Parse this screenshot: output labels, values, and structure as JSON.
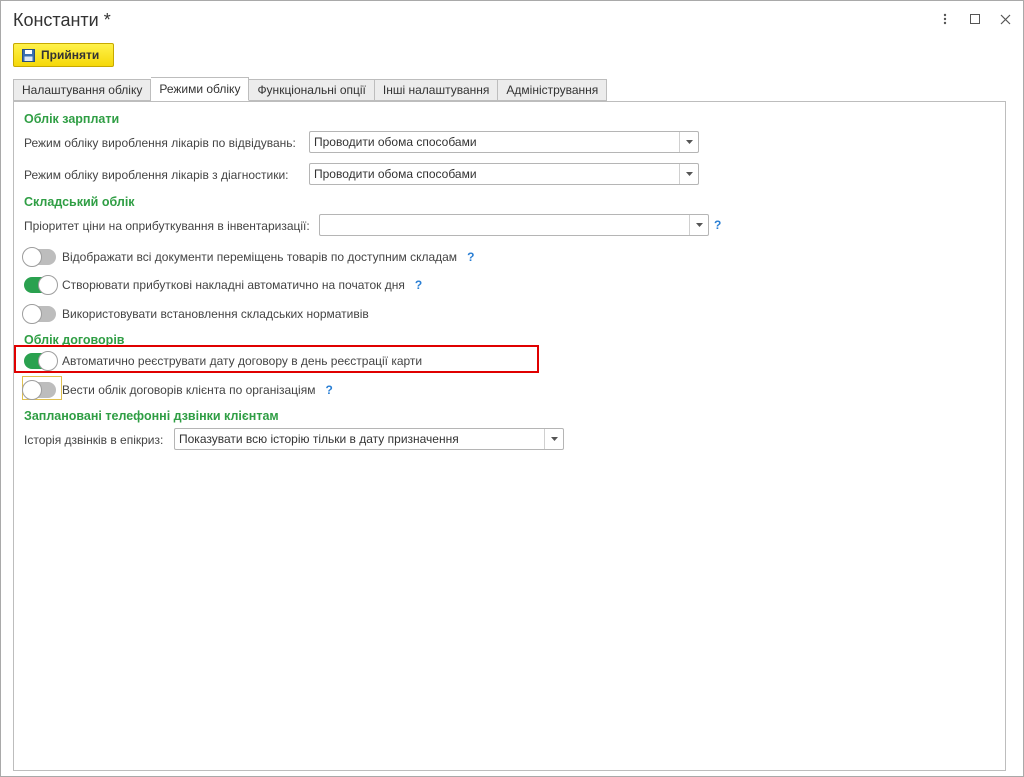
{
  "window": {
    "title": "Константи *"
  },
  "toolbar": {
    "accept_label": "Прийняти"
  },
  "tabs": [
    {
      "label": "Налаштування обліку",
      "active": false
    },
    {
      "label": "Режими обліку",
      "active": true
    },
    {
      "label": "Функціональні опції",
      "active": false
    },
    {
      "label": "Інші налаштування",
      "active": false
    },
    {
      "label": "Адміністрування",
      "active": false
    }
  ],
  "salary": {
    "heading": "Облік зарплати",
    "visits_label": "Режим обліку вироблення лікарів по відвідувань:",
    "visits_value": "Проводити обома способами",
    "diagnostics_label": "Режим обліку вироблення лікарів з діагностики:",
    "diagnostics_value": "Проводити обома способами"
  },
  "warehouse": {
    "heading": "Складський облік",
    "price_priority_label": "Пріоритет ціни на оприбуткування в інвентаризації:",
    "price_priority_value": "",
    "help_mark": "?",
    "toggles": [
      {
        "label": "Відображати всі документи переміщень товарів по доступним складам",
        "on": false,
        "help": "?"
      },
      {
        "label": "Створювати прибуткові накладні автоматично на початок дня",
        "on": true,
        "help": "?"
      },
      {
        "label": "Використовувати встановлення складських нормативів",
        "on": false,
        "help": ""
      }
    ]
  },
  "contracts": {
    "heading": "Облік договорів",
    "toggles": [
      {
        "label": "Автоматично реєструвати дату договору в день реєстрації карти",
        "on": true,
        "help": ""
      },
      {
        "label": "Вести облік договорів клієнта по організаціям",
        "on": false,
        "help": "?"
      }
    ]
  },
  "calls": {
    "heading": "Заплановані телефонні дзвінки клієнтам",
    "history_label": "Історія дзвінків в епікриз:",
    "history_value": "Показувати всю історію тільки в дату призначення"
  },
  "colors": {
    "section_heading": "#2f9e44",
    "toggle_on": "#2aa14f",
    "highlight": "#e00000",
    "accept_button": "#f5d80a",
    "help": "#2a7fd4"
  }
}
